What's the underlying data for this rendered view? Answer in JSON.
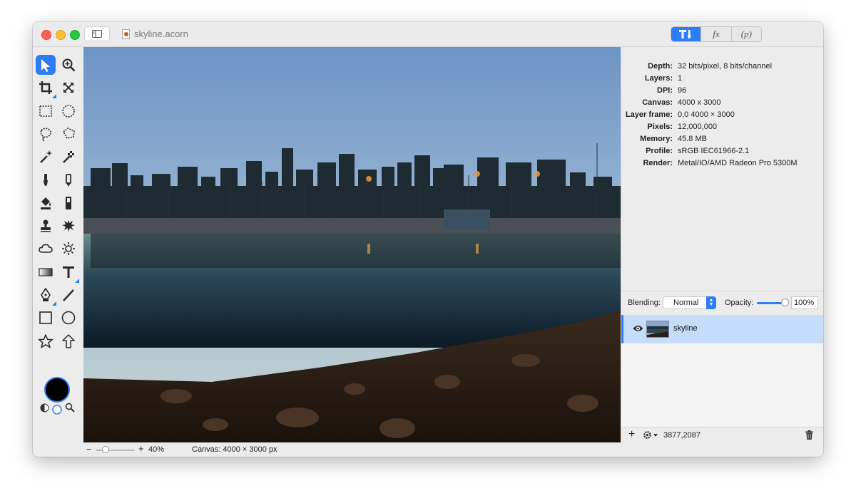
{
  "window": {
    "doc_title": "skyline.acorn",
    "inspector_tabs": [
      "tools-icon",
      "fx",
      "(p)"
    ]
  },
  "tools": [
    {
      "name": "move-tool",
      "icon": "arrow-pointer-icon",
      "active": true
    },
    {
      "name": "zoom-tool",
      "icon": "magnifier-plus-icon"
    },
    {
      "name": "crop-tool",
      "icon": "crop-icon"
    },
    {
      "name": "transform-tool",
      "icon": "resize-arrows-icon"
    },
    {
      "name": "rect-select-tool",
      "icon": "rect-marquee-icon"
    },
    {
      "name": "ellipse-select-tool",
      "icon": "ellipse-marquee-icon"
    },
    {
      "name": "lasso-tool",
      "icon": "lasso-icon"
    },
    {
      "name": "polygon-lasso-tool",
      "icon": "polygon-lasso-icon"
    },
    {
      "name": "magic-wand-tool",
      "icon": "magic-wand-icon"
    },
    {
      "name": "instant-alpha-tool",
      "icon": "instant-alpha-icon"
    },
    {
      "name": "brush-tool",
      "icon": "brush-icon"
    },
    {
      "name": "pencil-tool",
      "icon": "pencil-icon"
    },
    {
      "name": "paint-bucket-tool",
      "icon": "paint-bucket-icon"
    },
    {
      "name": "eraser-tool",
      "icon": "eraser-icon"
    },
    {
      "name": "clone-stamp-tool",
      "icon": "stamp-icon"
    },
    {
      "name": "effects-brush-tool",
      "icon": "splat-icon"
    },
    {
      "name": "smudge-tool",
      "icon": "cloud-icon"
    },
    {
      "name": "dodge-tool",
      "icon": "sun-icon"
    },
    {
      "name": "gradient-tool",
      "icon": "gradient-icon"
    },
    {
      "name": "text-tool",
      "icon": "text-icon"
    },
    {
      "name": "pen-tool",
      "icon": "pen-nib-icon"
    },
    {
      "name": "line-tool",
      "icon": "line-icon"
    },
    {
      "name": "rectangle-tool",
      "icon": "rectangle-icon"
    },
    {
      "name": "oval-tool",
      "icon": "circle-icon"
    },
    {
      "name": "star-tool",
      "icon": "star-icon"
    },
    {
      "name": "arrow-shape-tool",
      "icon": "up-arrow-icon"
    }
  ],
  "colors": {
    "accent": "#2f7df6",
    "foreground_color": "#000000",
    "selected_layer_bg": "#c6dcfb"
  },
  "info": {
    "rows": [
      {
        "key": "Depth:",
        "value": "32 bits/pixel, 8 bits/channel"
      },
      {
        "key": "Layers:",
        "value": "1"
      },
      {
        "key": "DPI:",
        "value": "96"
      },
      {
        "key": "Canvas:",
        "value": "4000 x 3000"
      },
      {
        "key": "Layer frame:",
        "value": "0,0 4000 × 3000"
      },
      {
        "key": "Pixels:",
        "value": "12,000,000"
      },
      {
        "key": "Memory:",
        "value": "45.8 MB"
      },
      {
        "key": "Profile:",
        "value": "sRGB IEC61966-2.1"
      },
      {
        "key": "Render:",
        "value": "Metal/IO/AMD Radeon Pro 5300M"
      }
    ]
  },
  "layers": {
    "blending_label": "Blending:",
    "blending_value": "Normal",
    "opacity_label": "Opacity:",
    "opacity_value": "100%",
    "opacity_level": 1.0,
    "items": [
      {
        "name": "skyline",
        "visible": true,
        "selected": true
      }
    ],
    "cursor_coords": "3877,2087"
  },
  "status": {
    "zoom_minus": "−",
    "zoom_plus": "+",
    "zoom_value": "40%",
    "zoom_level": 0.4,
    "canvas_size": "Canvas: 4000 × 3000 px"
  }
}
